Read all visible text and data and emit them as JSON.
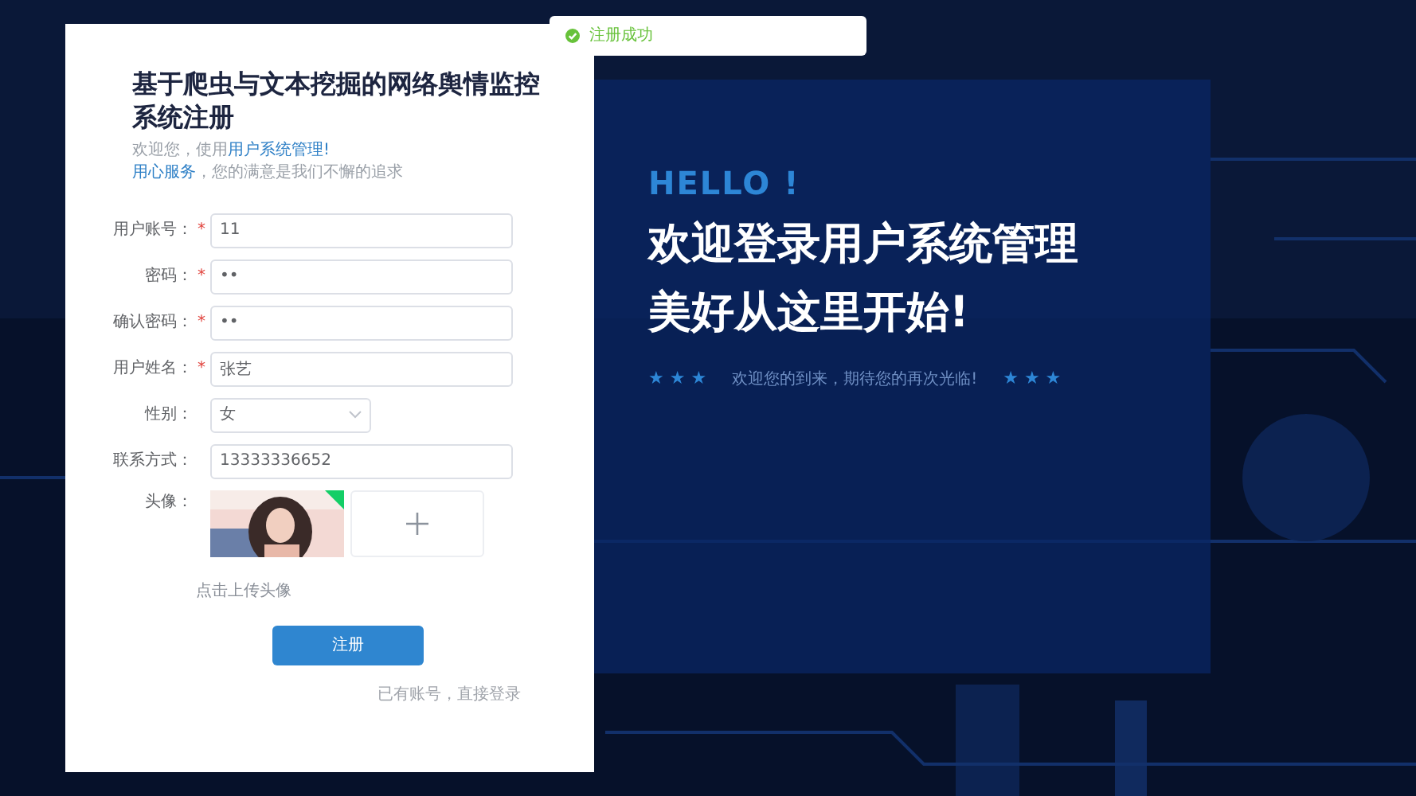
{
  "toast": {
    "kind": "success",
    "text": "注册成功"
  },
  "form": {
    "title": "基于爬虫与文本挖掘的网络舆情监控系统注册",
    "intro": [
      [
        {
          "text": "欢迎您，使用",
          "highlight": false
        },
        {
          "text": "用户系统管理!",
          "highlight": true
        }
      ],
      [
        {
          "text": "用心服务",
          "highlight": true
        },
        {
          "text": "，您的满意是我们不懈的追求",
          "highlight": false
        }
      ]
    ],
    "fields": [
      {
        "kind": "text",
        "label": "用户账号：",
        "required": true,
        "value": "11"
      },
      {
        "kind": "text",
        "label": "密码：",
        "required": true,
        "value": "••"
      },
      {
        "kind": "text",
        "label": "确认密码：",
        "required": true,
        "value": "••"
      },
      {
        "kind": "text",
        "label": "用户姓名：",
        "required": true,
        "value": "张艺"
      },
      {
        "kind": "select",
        "label": "性别：",
        "required": false,
        "value": "女"
      },
      {
        "kind": "text",
        "label": "联系方式：",
        "required": false,
        "value": "13333336652"
      },
      {
        "kind": "upload",
        "label": "头像：",
        "required": false,
        "hint": "点击上传头像"
      }
    ],
    "required_mark": "*",
    "submit": "注册",
    "login_link": "已有账号，直接登录"
  },
  "welcome": {
    "hello": "HELLO !",
    "headline": [
      "欢迎登录用户系统管理",
      "美好从这里开始!"
    ],
    "stars_left": "★ ★ ★",
    "tagline": "欢迎您的到来，期待您的再次光临!",
    "stars_right": "★ ★ ★"
  }
}
